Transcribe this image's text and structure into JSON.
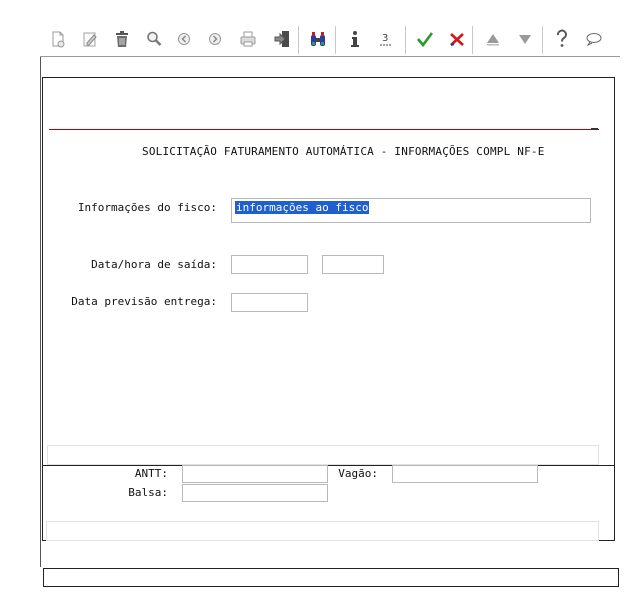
{
  "toolbar": {
    "buttons": [
      {
        "name": "new-document-icon",
        "title": "Novo"
      },
      {
        "name": "edit-icon",
        "title": "Alterar"
      },
      {
        "name": "delete-icon",
        "title": "Excluir"
      },
      {
        "name": "search-icon",
        "title": "Pesquisar"
      },
      {
        "name": "previous-icon",
        "title": "Anterior"
      },
      {
        "name": "next-icon",
        "title": "Próximo"
      },
      {
        "name": "print-icon",
        "title": "Imprimir"
      },
      {
        "name": "exit-icon",
        "title": "Sair"
      },
      {
        "name": "binoculars-icon",
        "title": "Localizar"
      },
      {
        "name": "info-icon",
        "title": "Informação"
      },
      {
        "name": "sequence-icon",
        "title": "Sequência"
      },
      {
        "name": "confirm-icon",
        "title": "Confirmar"
      },
      {
        "name": "cancel-icon",
        "title": "Cancelar"
      },
      {
        "name": "arrow-up-icon",
        "title": "Subir"
      },
      {
        "name": "arrow-down-icon",
        "title": "Descer"
      },
      {
        "name": "help-icon",
        "title": "Ajuda"
      },
      {
        "name": "comment-icon",
        "title": "Comentário"
      }
    ]
  },
  "form": {
    "title": "SOLICITAÇÃO FATURAMENTO AUTOMÁTICA - INFORMAÇÕES COMPL NF-E",
    "fisco_label": "Informações do fisco:",
    "fisco_value": "informações ao fisco",
    "saida_label": "Data/hora de saída:",
    "saida_date": "",
    "saida_time": "",
    "previsao_label": "Data previsão entrega:",
    "previsao_value": ""
  },
  "transport": {
    "antt_label": "ANTT:",
    "antt_value": "",
    "vagao_label": "Vagão:",
    "vagao_value": "",
    "balsa_label": "Balsa:",
    "balsa_value": ""
  },
  "colors": {
    "accent_red": "#b30000",
    "selection_blue": "#1f5fcf",
    "confirm_green": "#2a9a2a",
    "cancel_red": "#d01818"
  }
}
